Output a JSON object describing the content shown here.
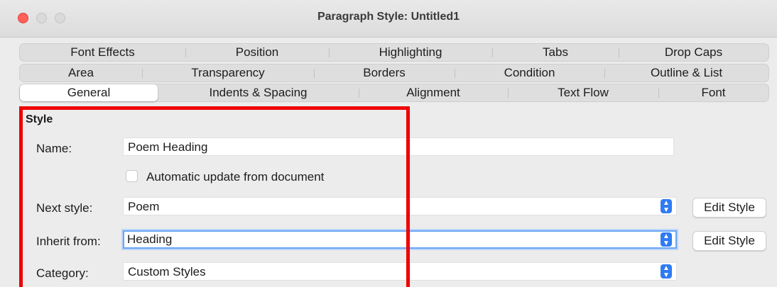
{
  "window": {
    "title": "Paragraph Style: Untitled1"
  },
  "tabs": {
    "row1": [
      "Font Effects",
      "Position",
      "Highlighting",
      "Tabs",
      "Drop Caps"
    ],
    "row2": [
      "Area",
      "Transparency",
      "Borders",
      "Condition",
      "Outline & List"
    ],
    "row3": [
      "General",
      "Indents & Spacing",
      "Alignment",
      "Text Flow",
      "Font"
    ],
    "active": "General"
  },
  "style_section": {
    "title": "Style",
    "name_label": "Name:",
    "name_value": "Poem Heading",
    "auto_update_label": "Automatic update from document",
    "auto_update_checked": false,
    "next_style_label": "Next style:",
    "next_style_value": "Poem",
    "inherit_label": "Inherit from:",
    "inherit_value": "Heading",
    "category_label": "Category:",
    "category_value": "Custom Styles",
    "edit_style_label": "Edit Style"
  },
  "colors": {
    "accent": "#2f7bf5",
    "highlight_box": "#ee0000",
    "focus_ring": "#6aa5f4"
  },
  "icons": {
    "stepper": "up-down-chevron-icon"
  }
}
